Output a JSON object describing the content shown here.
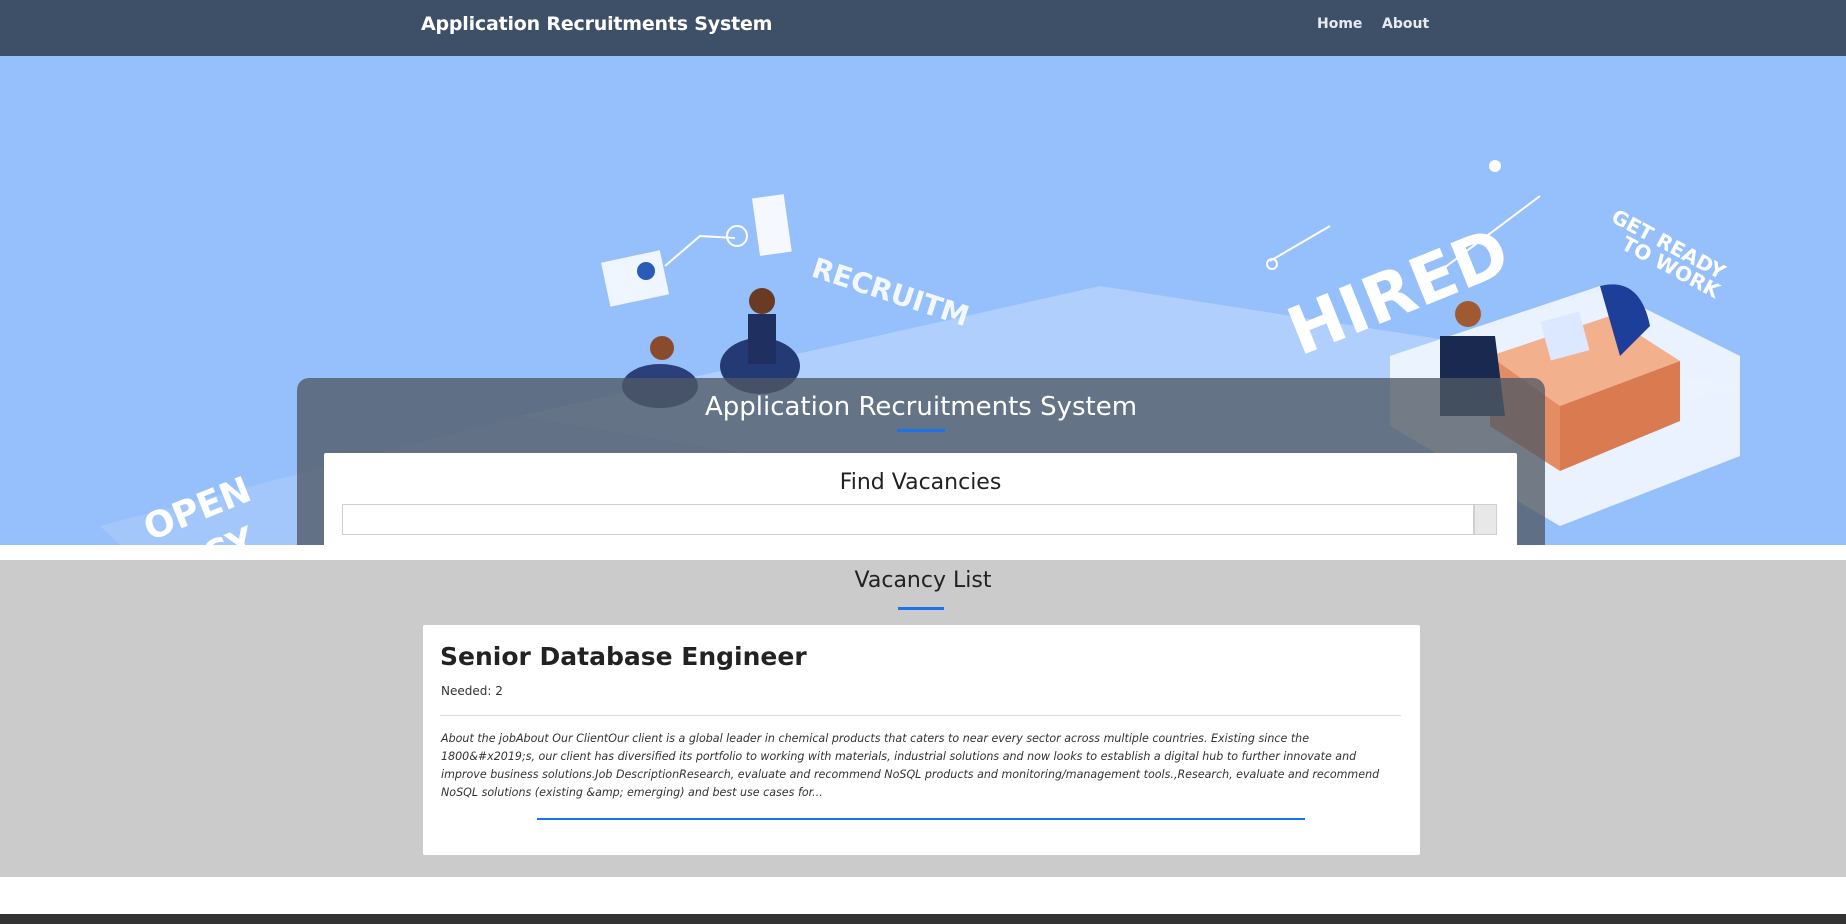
{
  "navbar": {
    "brand": "Application Recruitments System",
    "links": [
      {
        "label": "Home"
      },
      {
        "label": "About"
      }
    ]
  },
  "hero": {
    "title": "Application Recruitments System",
    "illustration_text": {
      "hired": "HIRED",
      "get_ready": "GET READY",
      "to_work": "TO WORK",
      "open": "OPEN",
      "vacancy": "ANCY",
      "recruit": "RECRUITM"
    },
    "search": {
      "title": "Find Vacancies",
      "value": "",
      "placeholder": ""
    }
  },
  "vacancies": {
    "title": "Vacancy List",
    "items": [
      {
        "title": "Senior Database Engineer",
        "needed_label": "Needed:",
        "needed": "2",
        "description": "About the jobAbout Our ClientOur client is a global leader in chemical products that caters to near every sector across multiple countries. Existing since the 1800&#x2019;s, our client has diversified its portfolio to working with materials, industrial solutions and now looks to establish a digital hub to further innovate and improve business solutions.Job DescriptionResearch, evaluate and recommend NoSQL products and monitoring/management tools.,Research, evaluate and recommend NoSQL solutions (existing &amp; emerging) and best use cases for..."
      }
    ]
  },
  "colors": {
    "navbar": "#3e5068",
    "hero_background": "#95c0fb",
    "accent": "#1a73e8",
    "section_background": "#cbcbcb"
  }
}
